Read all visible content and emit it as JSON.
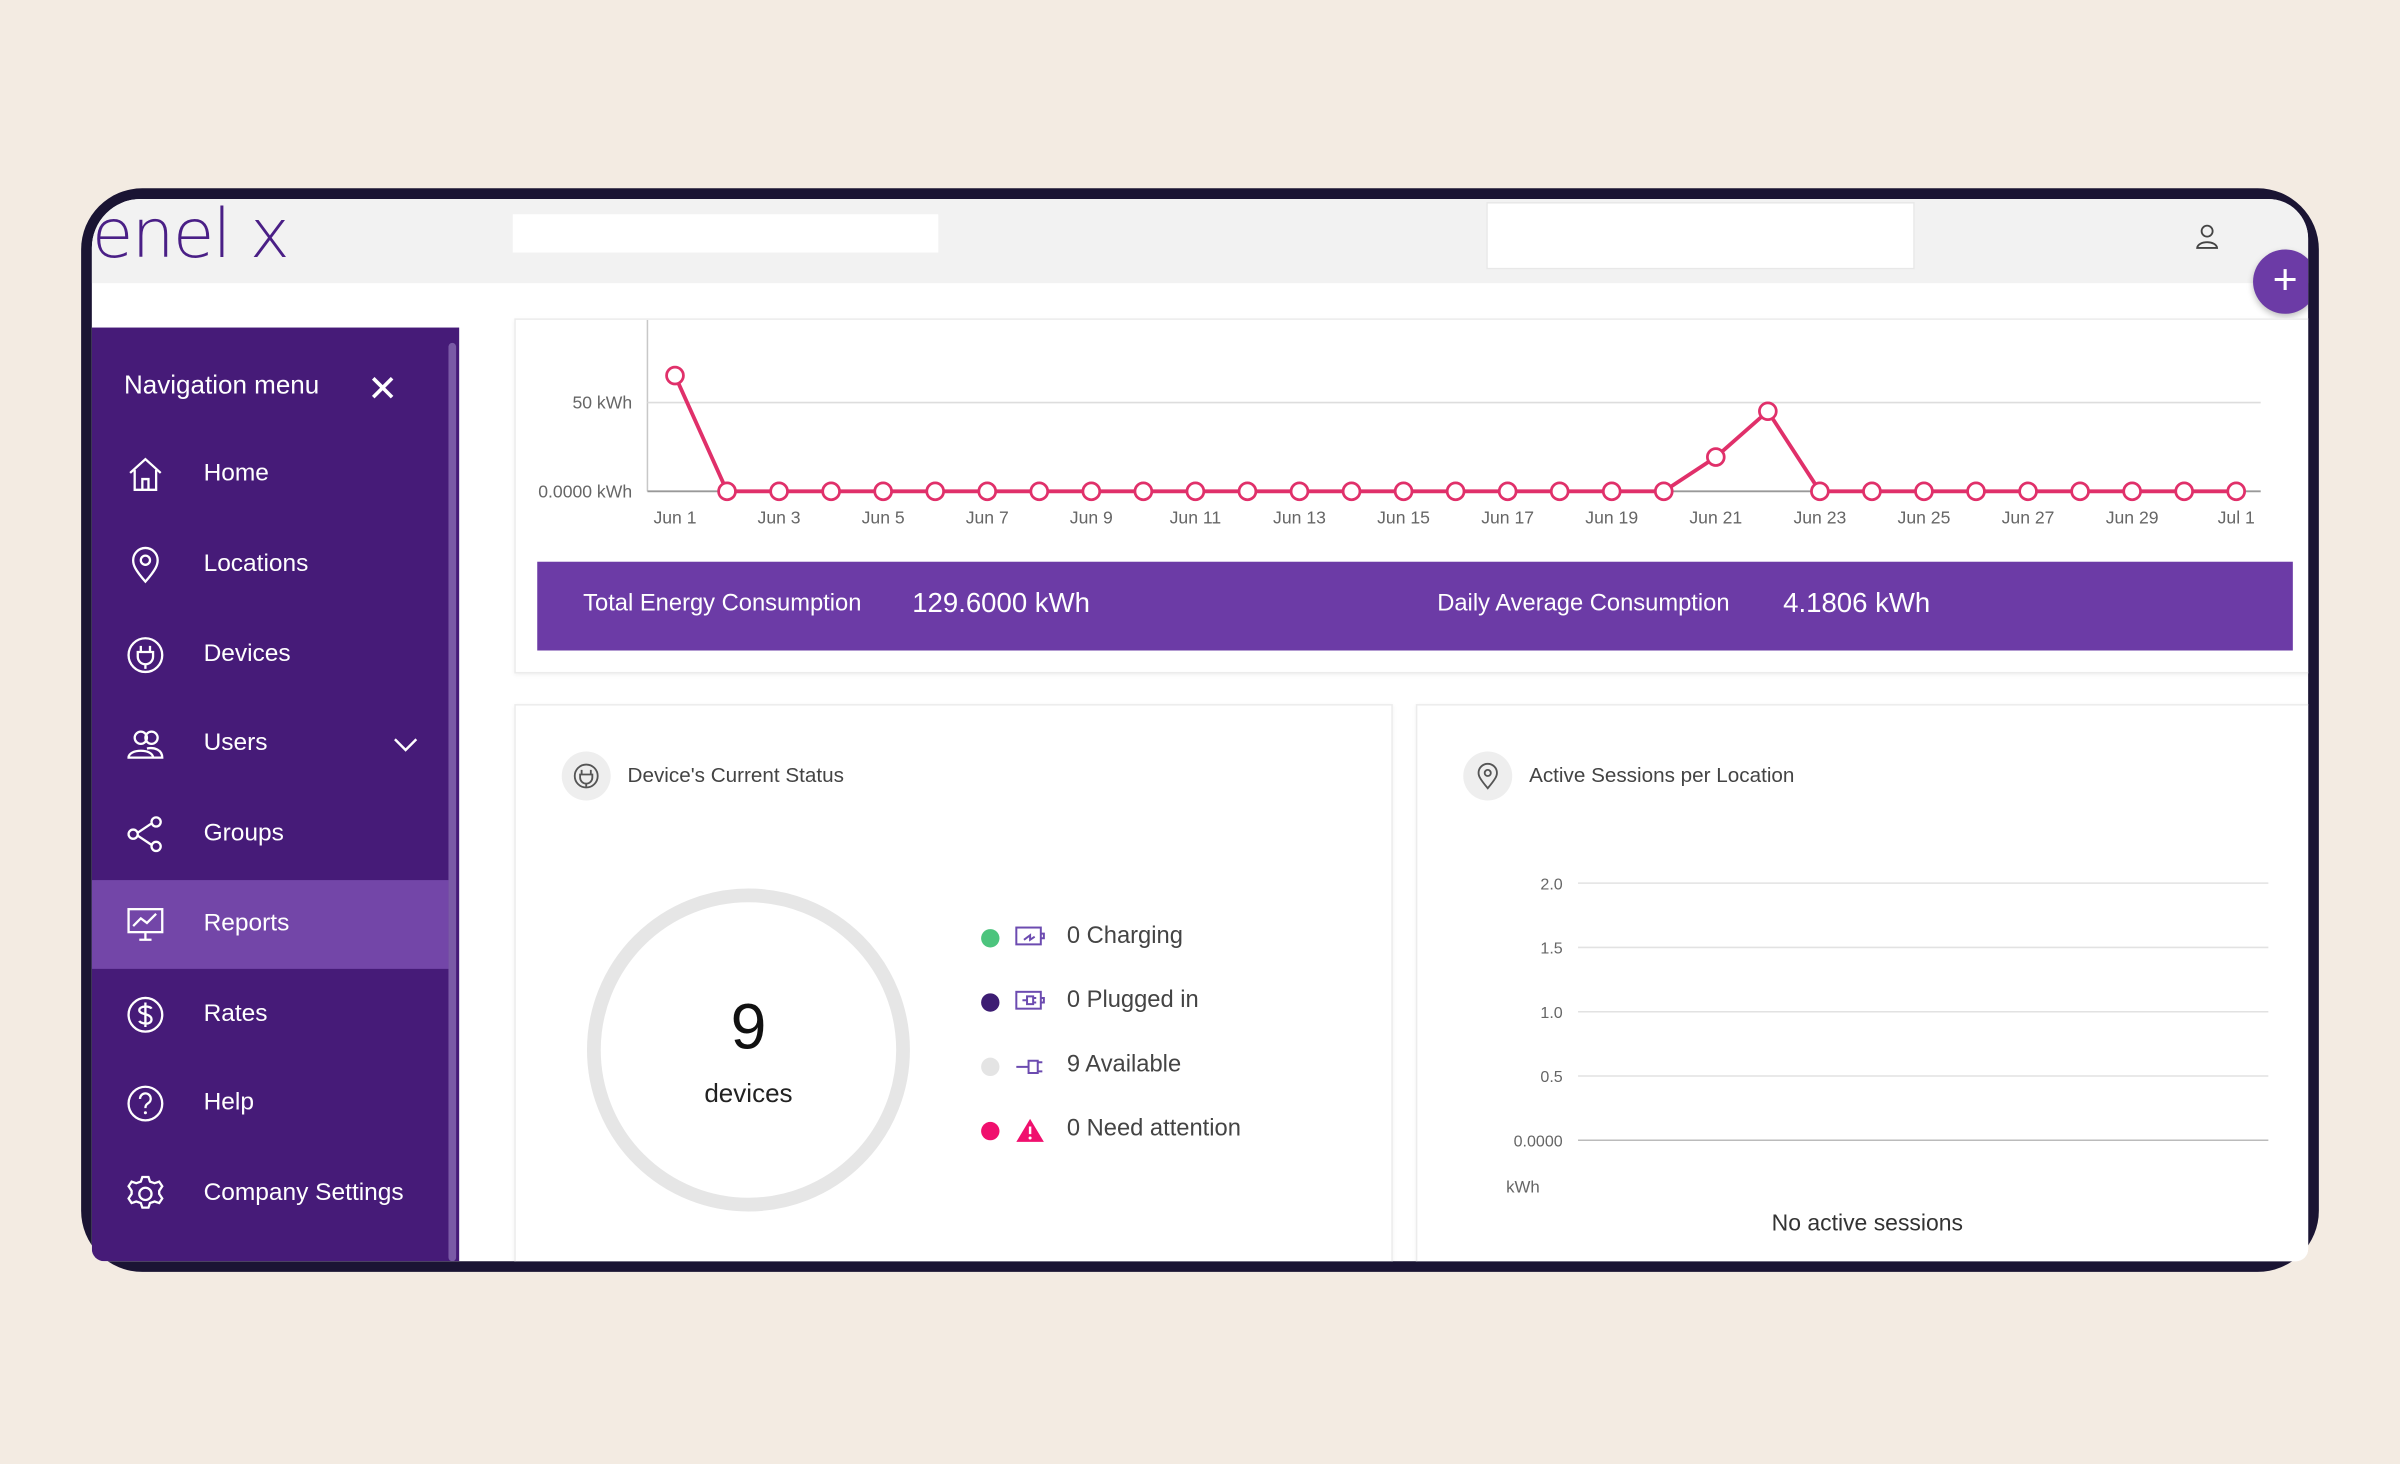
{
  "brand": {
    "logo_text": "enel x",
    "accent": "#461b78"
  },
  "header": {
    "user_icon": "user-icon",
    "add_icon": "plus-icon"
  },
  "sidebar": {
    "title": "Navigation menu",
    "items": [
      {
        "label": "Home",
        "icon": "home-icon"
      },
      {
        "label": "Locations",
        "icon": "location-pin-icon"
      },
      {
        "label": "Devices",
        "icon": "plug-icon"
      },
      {
        "label": "Users",
        "icon": "users-icon",
        "expandable": true
      },
      {
        "label": "Groups",
        "icon": "share-icon"
      },
      {
        "label": "Reports",
        "icon": "monitor-chart-icon",
        "active": true
      },
      {
        "label": "Rates",
        "icon": "dollar-icon"
      },
      {
        "label": "Help",
        "icon": "help-icon"
      },
      {
        "label": "Company Settings",
        "icon": "gear-icon"
      }
    ]
  },
  "chart_data": [
    {
      "type": "line",
      "x": [
        "Jun 1",
        "Jun 2",
        "Jun 3",
        "Jun 4",
        "Jun 5",
        "Jun 6",
        "Jun 7",
        "Jun 8",
        "Jun 9",
        "Jun 10",
        "Jun 11",
        "Jun 12",
        "Jun 13",
        "Jun 14",
        "Jun 15",
        "Jun 16",
        "Jun 17",
        "Jun 18",
        "Jun 19",
        "Jun 20",
        "Jun 21",
        "Jun 22",
        "Jun 23",
        "Jun 24",
        "Jun 25",
        "Jun 26",
        "Jun 27",
        "Jun 28",
        "Jun 29",
        "Jun 30",
        "Jul 1"
      ],
      "x_tick_labels": [
        "Jun 1",
        "Jun 3",
        "Jun 5",
        "Jun 7",
        "Jun 9",
        "Jun 11",
        "Jun 13",
        "Jun 15",
        "Jun 17",
        "Jun 19",
        "Jun 21",
        "Jun 23",
        "Jun 25",
        "Jun 27",
        "Jun 29",
        "Jul 1"
      ],
      "series": [
        {
          "values": [
            65.2,
            0,
            0,
            0,
            0,
            0,
            0,
            0,
            0,
            0,
            0,
            0,
            0,
            0,
            0,
            0,
            0,
            0,
            0,
            0,
            19.3,
            45.1,
            0,
            0,
            0,
            0,
            0,
            0,
            0,
            0,
            0
          ],
          "color": "#e0306a"
        }
      ],
      "y_tick_labels": [
        "0.0000 kWh",
        "50 kWh"
      ],
      "y_ticks": [
        0,
        50
      ],
      "ylim": [
        0,
        97
      ],
      "grid": true
    },
    {
      "type": "line",
      "title": "Active Sessions per Location",
      "y_tick_labels": [
        "0.0000",
        "0.5",
        "1.0",
        "1.5",
        "2.0"
      ],
      "y_ticks": [
        0,
        0.5,
        1.0,
        1.5,
        2.0
      ],
      "ylim": [
        0,
        2
      ],
      "ylabel": "kWh",
      "series": [],
      "empty_message": "No active sessions",
      "grid": true
    }
  ],
  "summary": {
    "total_label": "Total Energy Consumption",
    "total_value": "129.6000 kWh",
    "avg_label": "Daily Average Consumption",
    "avg_value": "4.1806 kWh"
  },
  "status": {
    "title": "Device's Current Status",
    "count": "9",
    "count_label": "devices",
    "items": [
      {
        "label": "0 Charging",
        "color": "#4cc47d",
        "icon": "charging-icon"
      },
      {
        "label": "0 Plugged in",
        "color": "#3d1d73",
        "icon": "plugged-in-icon"
      },
      {
        "label": "9 Available",
        "color": "#e4e4e4",
        "icon": "plug-cable-icon"
      },
      {
        "label": "0 Need attention",
        "color": "#f0106e",
        "icon": "warning-icon"
      }
    ]
  }
}
